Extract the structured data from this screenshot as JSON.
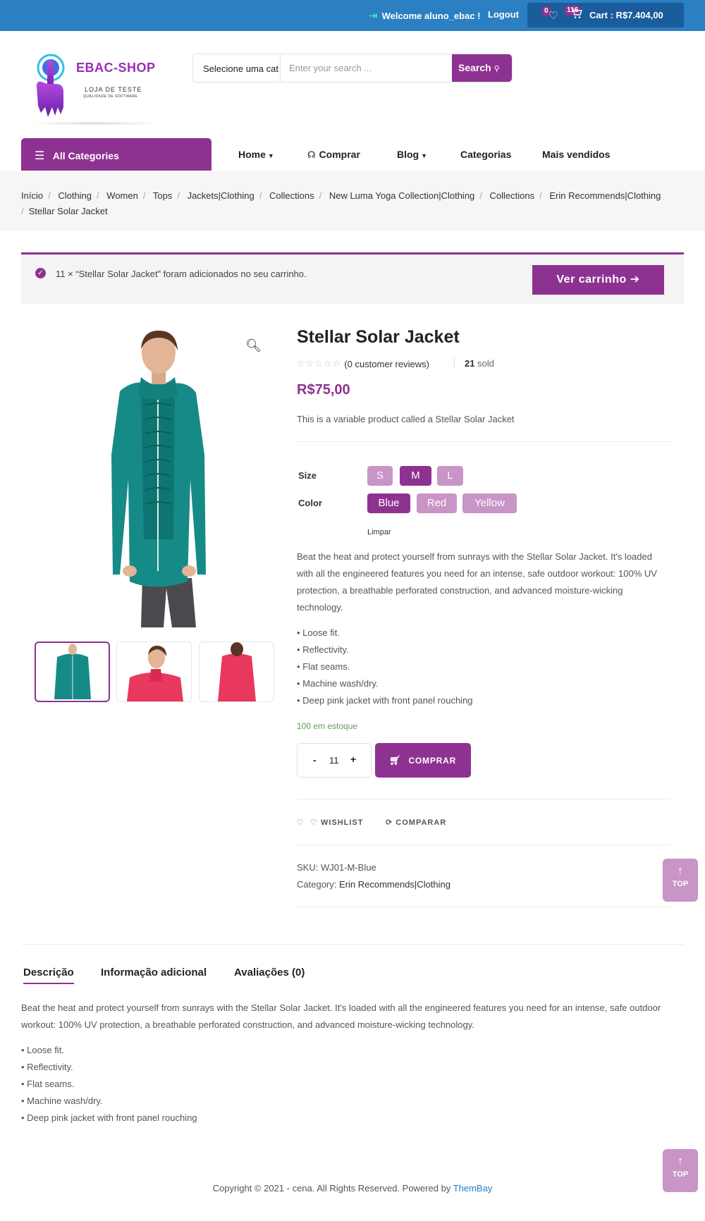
{
  "topbar": {
    "welcome": "Welcome aluno_ebac !",
    "logout": "Logout",
    "wishlist_count": "0",
    "cart_count": "116",
    "cart_total": "Cart : R$7.404,00"
  },
  "logo": {
    "title": "EBAC-SHOP",
    "subtitle": "LOJA DE TESTE",
    "tagline": "QUALIDADE DE SOFTWARE"
  },
  "search": {
    "category": "Selecione uma cat",
    "placeholder": "Enter your search ...",
    "button": "Search"
  },
  "nav": {
    "all_categories": "All Categories",
    "items": [
      "Home",
      "Comprar",
      "Blog",
      "Categorias",
      "Mais vendidos"
    ]
  },
  "breadcrumb": [
    "Início",
    "Clothing",
    "Women",
    "Tops",
    "Jackets|Clothing",
    "Collections",
    "New Luma Yoga Collection|Clothing",
    "Collections",
    "Erin Recommends|Clothing",
    "Stellar Solar Jacket"
  ],
  "notice": {
    "message": "11 × “Stellar Solar Jacket” foram adicionados no seu carrinho.",
    "button": "Ver carrinho"
  },
  "product": {
    "title": "Stellar Solar Jacket",
    "rating": 0,
    "reviews": "(0 customer reviews)",
    "sold_count": "21",
    "sold_label": "sold",
    "price": "R$75,00",
    "short_description": "This is a variable product called a Stellar Solar Jacket",
    "size_label": "Size",
    "sizes": [
      "S",
      "M",
      "L"
    ],
    "selected_size": "M",
    "color_label": "Color",
    "colors": [
      "Blue",
      "Red",
      "Yellow"
    ],
    "selected_color": "Blue",
    "clear": "Limpar",
    "description": "Beat the heat and protect yourself from sunrays with the Stellar Solar Jacket. It's loaded with all the engineered features you need for an intense, safe outdoor workout: 100% UV protection, a breathable perforated construction, and advanced moisture-wicking technology.",
    "features": [
      "• Loose fit.",
      "• Reflectivity.",
      "• Flat seams.",
      "• Machine wash/dry.",
      "• Deep pink jacket with front panel rouching"
    ],
    "stock": "100 em estoque",
    "quantity": "11",
    "minus": "-",
    "plus": "+",
    "buy_button": "COMPRAR",
    "wishlist": "WISHLIST",
    "compare": "COMPARAR",
    "sku_label": "SKU:",
    "sku": "WJ01-M-Blue",
    "category_label": "Category:",
    "category": "Erin Recommends|Clothing"
  },
  "top_button": "TOP",
  "tabs": {
    "items": [
      "Descrição",
      "Informação adicional",
      "Avaliações (0)"
    ],
    "description": "Beat the heat and protect yourself from sunrays with the Stellar Solar Jacket. It's loaded with all the engineered features you need for an intense, safe outdoor workout: 100% UV protection, a breathable perforated construction, and advanced moisture-wicking technology.",
    "features": [
      "• Loose fit.",
      "• Reflectivity.",
      "• Flat seams.",
      "• Machine wash/dry.",
      "• Deep pink jacket with front panel rouching"
    ]
  },
  "footer": {
    "text": "Copyright © 2021 - cena. All Rights Reserved. Powered by",
    "brand": "ThemBay"
  },
  "colors": {
    "accent": "#8e3291",
    "accent_light": "#c994c6",
    "topbar": "#2b7fc2",
    "stock": "#5f9e54"
  }
}
